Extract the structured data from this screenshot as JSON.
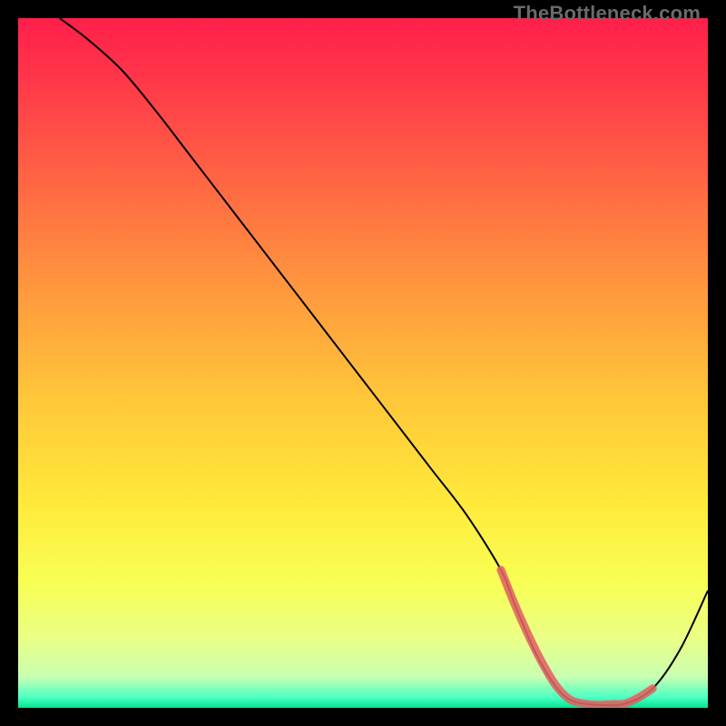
{
  "watermark": "TheBottleneck.com",
  "chart_data": {
    "type": "line",
    "title": "",
    "xlabel": "",
    "ylabel": "",
    "xlim": [
      0,
      100
    ],
    "ylim": [
      0,
      100
    ],
    "grid": false,
    "legend": false,
    "background_gradient": {
      "stops": [
        {
          "offset": 0.0,
          "color": "#ff1f4b"
        },
        {
          "offset": 0.1,
          "color": "#ff3a49"
        },
        {
          "offset": 0.25,
          "color": "#ff6a43"
        },
        {
          "offset": 0.4,
          "color": "#ff9a3e"
        },
        {
          "offset": 0.55,
          "color": "#ffc63a"
        },
        {
          "offset": 0.7,
          "color": "#ffe93a"
        },
        {
          "offset": 0.82,
          "color": "#f8ff55"
        },
        {
          "offset": 0.9,
          "color": "#eaff86"
        },
        {
          "offset": 0.955,
          "color": "#c9ffb0"
        },
        {
          "offset": 0.985,
          "color": "#4dffc3"
        },
        {
          "offset": 1.0,
          "color": "#00e591"
        }
      ]
    },
    "series": [
      {
        "name": "bottleneck-curve",
        "color": "#000000",
        "stroke_width": 2,
        "x": [
          6,
          10,
          15,
          20,
          25,
          30,
          35,
          40,
          45,
          50,
          55,
          60,
          65,
          70,
          72,
          75,
          78,
          80,
          82,
          85,
          88,
          92,
          96,
          100
        ],
        "y": [
          100,
          97,
          92.5,
          86.5,
          80,
          73.5,
          67,
          60.5,
          54,
          47.5,
          41,
          34.5,
          28,
          20,
          15,
          8,
          3,
          1.2,
          0.6,
          0.4,
          0.6,
          2.8,
          8.5,
          17
        ]
      },
      {
        "name": "optimal-band-marker",
        "color": "#e06363",
        "stroke_width": 9,
        "linecap": "round",
        "x": [
          70,
          72,
          74,
          76,
          78,
          80,
          82,
          84,
          86,
          88,
          90,
          92
        ],
        "y": [
          20,
          15,
          10.5,
          6.5,
          3.2,
          1.2,
          0.6,
          0.4,
          0.5,
          0.6,
          1.5,
          2.8
        ]
      }
    ]
  }
}
